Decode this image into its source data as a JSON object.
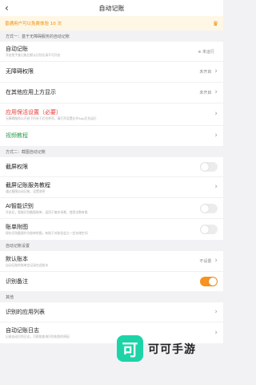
{
  "header": {
    "back_icon": "chevron-left-icon",
    "title": "自动记账"
  },
  "banner": {
    "text": "普通用户可以免费体验 10 次",
    "icon": "crown-icon"
  },
  "section1": {
    "title": "方式一：基于无障碍服务的自动记账",
    "rows": [
      {
        "label": "自动记账",
        "desc": "开启免手查记账后默认识别记录不可开启",
        "value": "未运行"
      },
      {
        "label": "无障碍权限",
        "value": "未开启"
      },
      {
        "label": "在其他应用上方显示",
        "value": "未开启"
      },
      {
        "label": "应用保活设置（必要）",
        "desc": "无障碍服务以开启下仍处于后台杀死，请打开设置允许App后台运行"
      },
      {
        "label": "视频教程"
      }
    ]
  },
  "section2": {
    "title": "方式二：截图自动记账",
    "rows": [
      {
        "label": "截屏权限"
      },
      {
        "label": "截屏记账服务教程",
        "desc": "通过截图自动记账，设置说明"
      },
      {
        "label": "AI智能识别",
        "desc": "开启后，智能识别截图账单，适用于复杂场景，使用次数有限"
      },
      {
        "label": "账单附图",
        "desc": "保存识别截图作为账单附图，有助于对账但会占一定存储空间"
      }
    ]
  },
  "section3": {
    "title": "自动记账设置",
    "rows": [
      {
        "label": "默认账本",
        "desc": "自动记账的账单会记录在此账本",
        "value": "不设置"
      },
      {
        "label": "识别备注"
      }
    ]
  },
  "section4": {
    "title": "其他",
    "rows": [
      {
        "label": "识别的应用列表"
      },
      {
        "label": "自动记账日志",
        "desc": "记录自动识别日志，可帮助查询识别失败的原因"
      }
    ]
  },
  "watermark": {
    "logo_char": "可",
    "text": "可可手游"
  },
  "colors": {
    "accent": "#f7931e",
    "red": "#e53935",
    "green": "#2e9e4f",
    "watermark": "#1dd4a8"
  }
}
